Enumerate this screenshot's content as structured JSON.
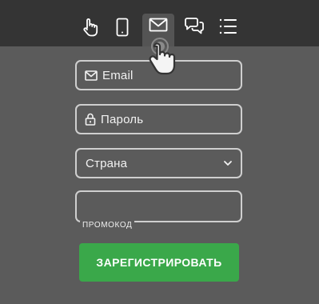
{
  "tabs": [
    {
      "icon": "touch-icon",
      "active": false
    },
    {
      "icon": "phone-icon",
      "active": false
    },
    {
      "icon": "mail-icon",
      "active": true
    },
    {
      "icon": "chat-icon",
      "active": false
    },
    {
      "icon": "list-icon",
      "active": false
    }
  ],
  "form": {
    "email_placeholder": "Email",
    "password_placeholder": "Пароль",
    "country_value": "Страна",
    "promo_label": "ПРОМОКОД",
    "submit_label": "ЗАРЕГИСТРИРОВАТЬ"
  },
  "colors": {
    "background": "#5b5b5b",
    "topbar": "#343434",
    "field_border": "#cfcfcf",
    "submit": "#3aa84a"
  },
  "cursor": {
    "icon": "hand-pointer-icon"
  }
}
